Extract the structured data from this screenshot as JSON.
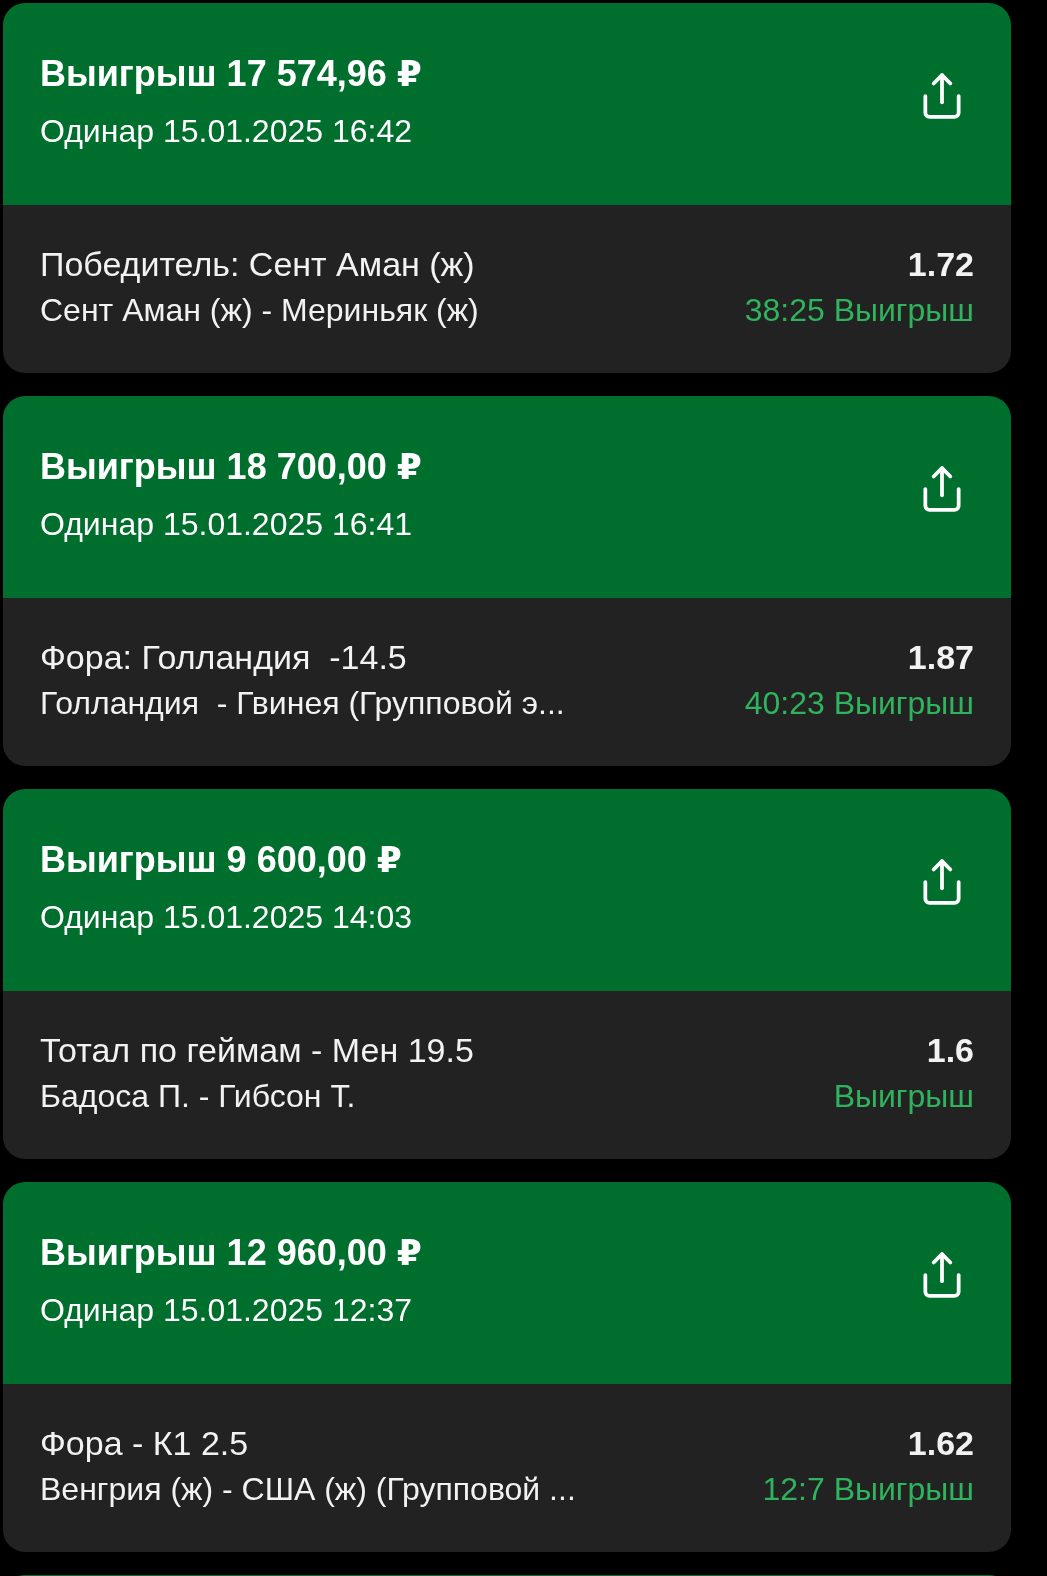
{
  "bets": [
    {
      "title": "Выигрыш 17 574,96 ₽",
      "subtitle": "Одинар 15.01.2025 16:42",
      "market": "Победитель: Сент Аман (ж)",
      "event": "Сент Аман (ж) - Мериньяк (ж)",
      "odds": "1.72",
      "result": "38:25 Выигрыш"
    },
    {
      "title": "Выигрыш 18 700,00 ₽",
      "subtitle": "Одинар 15.01.2025 16:41",
      "market": "Фора: Голландия  -14.5",
      "event": "Голландия  - Гвинея (Групповой э...",
      "odds": "1.87",
      "result": "40:23 Выигрыш"
    },
    {
      "title": "Выигрыш 9 600,00 ₽",
      "subtitle": "Одинар 15.01.2025 14:03",
      "market": "Тотал по геймам - Мен 19.5",
      "event": "Бадоса П. - Гибсон Т.",
      "odds": "1.6",
      "result": "Выигрыш"
    },
    {
      "title": "Выигрыш 12 960,00 ₽",
      "subtitle": "Одинар 15.01.2025 12:37",
      "market": "Фора - К1 2.5",
      "event": "Венгрия (ж) - США (ж) (Групповой ...",
      "odds": "1.62",
      "result": "12:7 Выигрыш"
    }
  ]
}
